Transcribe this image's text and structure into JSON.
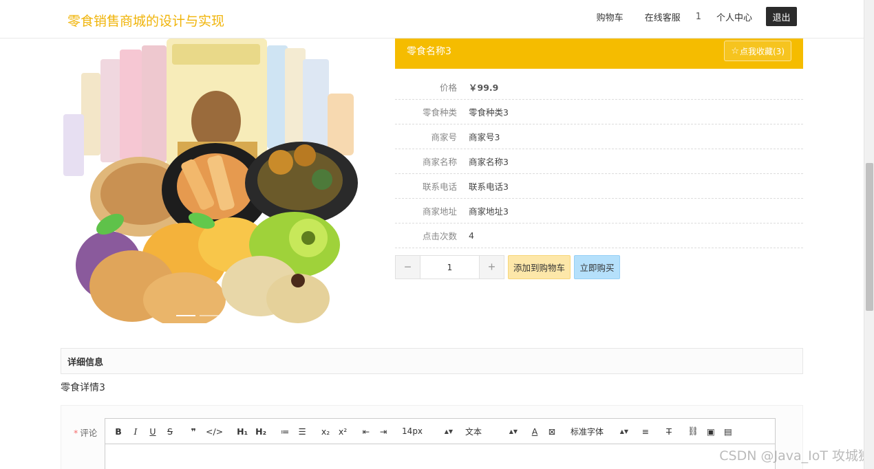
{
  "header": {
    "brand": "零食销售商城的设计与实现",
    "nav": {
      "cart": "购物车",
      "service": "在线客服",
      "count": "1",
      "profile": "个人中心",
      "logout": "退出"
    }
  },
  "product": {
    "name": "零食名称3",
    "favorite_label": "点我收藏(3)",
    "fields": [
      {
        "label": "价格",
        "value": "￥99.9"
      },
      {
        "label": "零食种类",
        "value": "零食种类3"
      },
      {
        "label": "商家号",
        "value": "商家号3"
      },
      {
        "label": "商家名称",
        "value": "商家名称3"
      },
      {
        "label": "联系电话",
        "value": "联系电话3"
      },
      {
        "label": "商家地址",
        "value": "商家地址3"
      },
      {
        "label": "点击次数",
        "value": "4"
      }
    ],
    "quantity": "1",
    "add_to_cart": "添加到购物车",
    "buy_now": "立即购买"
  },
  "detail": {
    "heading": "详细信息",
    "content": "零食详情3"
  },
  "comment": {
    "required_mark": "*",
    "label": "评论",
    "toolbar": {
      "font_size": "14px",
      "text_type": "文本",
      "font_family": "标准字体"
    }
  },
  "watermark": "CSDN @Java_IoT 攻城狮",
  "colors": {
    "brand": "#f0b40a",
    "title_bar": "#f5bc00",
    "cart_button": "#fde7a9",
    "buy_button": "#b5e0fb",
    "logout_button": "#2b2b2b"
  }
}
